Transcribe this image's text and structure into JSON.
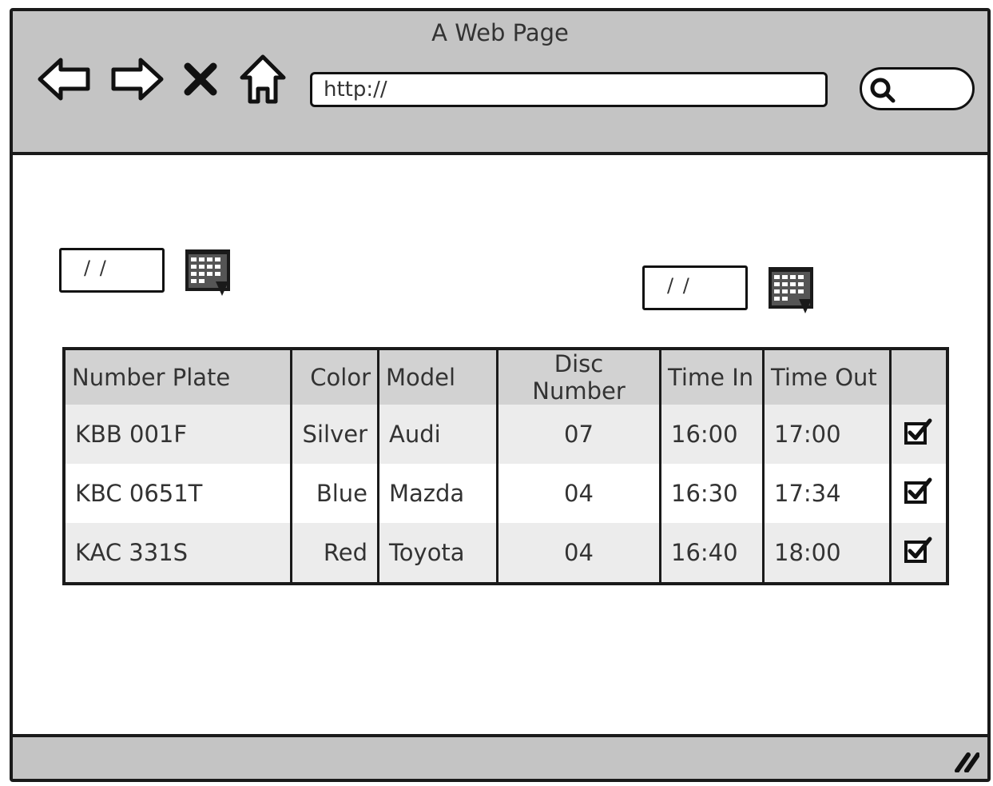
{
  "window": {
    "title": "A Web Page"
  },
  "toolbar": {
    "back_icon": "back-arrow-icon",
    "forward_icon": "forward-arrow-icon",
    "stop_icon": "close-icon",
    "home_icon": "home-icon"
  },
  "address": {
    "value": "http://"
  },
  "search": {
    "icon": "search-icon"
  },
  "date_from": {
    "value": "/ /",
    "icon": "calendar-icon"
  },
  "date_to": {
    "value": "/ /",
    "icon": "calendar-icon"
  },
  "table": {
    "headers": [
      "Number Plate",
      "Color",
      "Model",
      "Disc Number",
      "Time In",
      "Time Out",
      ""
    ],
    "rows": [
      {
        "plate": "KBB 001F",
        "color": "Silver",
        "model": "Audi",
        "disc": "07",
        "time_in": "16:00",
        "time_out": "17:00",
        "checked": true
      },
      {
        "plate": "KBC 0651T",
        "color": "Blue",
        "model": "Mazda",
        "disc": "04",
        "time_in": "16:30",
        "time_out": "17:34",
        "checked": true
      },
      {
        "plate": "KAC 331S",
        "color": "Red",
        "model": "Toyota",
        "disc": "04",
        "time_in": "16:40",
        "time_out": "18:00",
        "checked": true
      }
    ]
  },
  "colors": {
    "chrome": "#c4c4c4",
    "stroke": "#1a1a1a",
    "row_alt": "#ececec"
  }
}
